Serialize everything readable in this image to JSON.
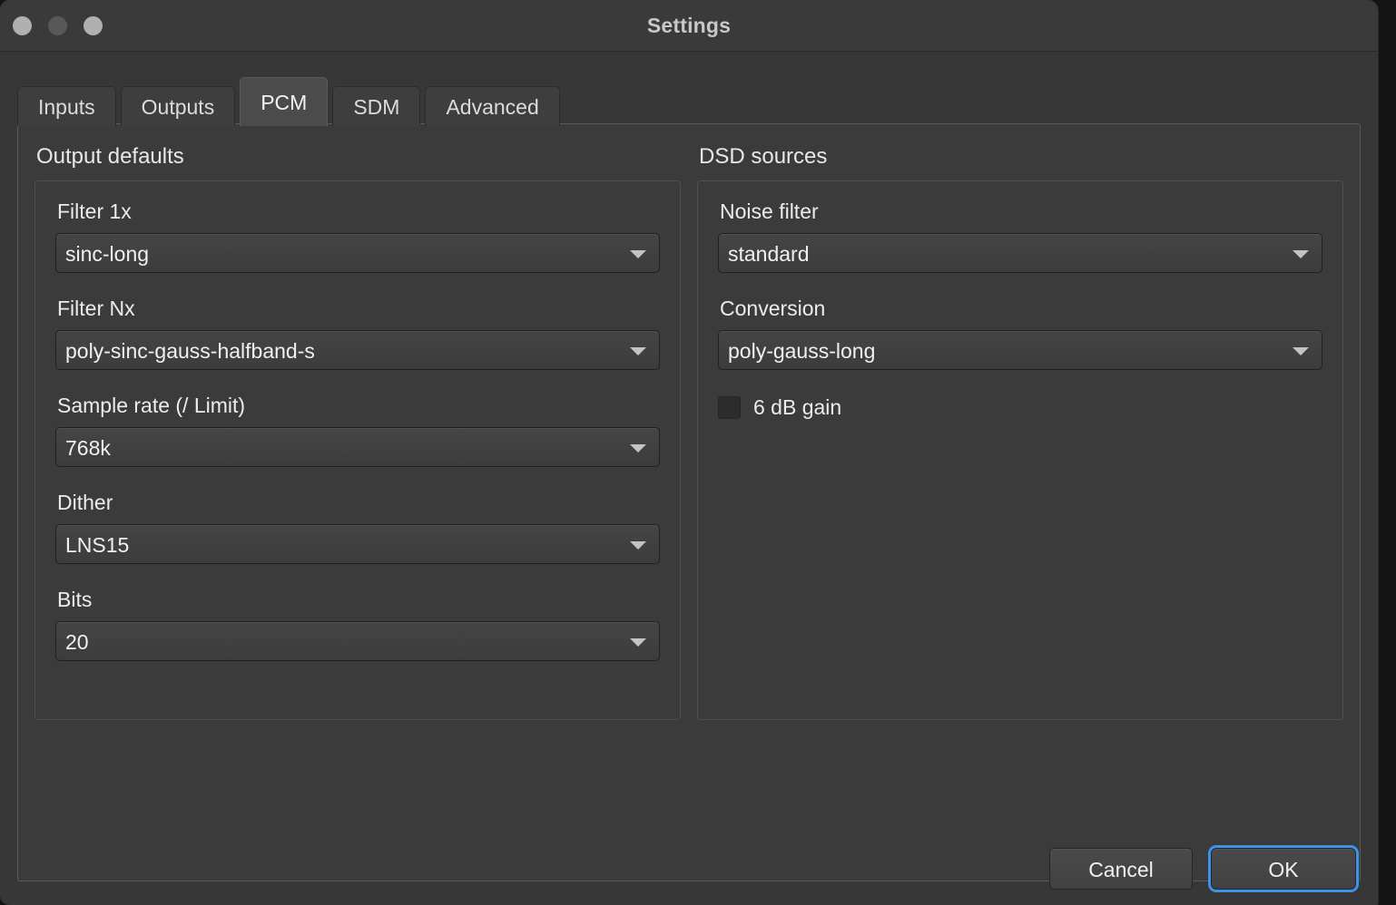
{
  "window": {
    "title": "Settings",
    "traffic_lights": [
      "close-button",
      "minimize-button",
      "zoom-button"
    ]
  },
  "tabs": [
    {
      "label": "Inputs",
      "active": false
    },
    {
      "label": "Outputs",
      "active": false
    },
    {
      "label": "PCM",
      "active": true
    },
    {
      "label": "SDM",
      "active": false
    },
    {
      "label": "Advanced",
      "active": false
    }
  ],
  "left_column": {
    "section_title": "Output defaults",
    "fields": [
      {
        "label": "Filter 1x",
        "value": "sinc-long"
      },
      {
        "label": "Filter Nx",
        "value": "poly-sinc-gauss-halfband-s"
      },
      {
        "label": "Sample rate (/ Limit)",
        "value": "768k"
      },
      {
        "label": "Dither",
        "value": "LNS15"
      },
      {
        "label": "Bits",
        "value": "20"
      }
    ]
  },
  "right_column": {
    "section_title": "DSD sources",
    "fields": [
      {
        "label": "Noise filter",
        "value": "standard"
      },
      {
        "label": "Conversion",
        "value": "poly-gauss-long"
      }
    ],
    "checkbox": {
      "label": "6 dB gain",
      "checked": false
    }
  },
  "footer": {
    "cancel_label": "Cancel",
    "ok_label": "OK"
  },
  "colors": {
    "window_background": "#373737",
    "panel_background": "#3b3b3b",
    "active_tab": "#4b4b4b",
    "text": "#ececec",
    "focus_ring": "#3e93e8"
  }
}
